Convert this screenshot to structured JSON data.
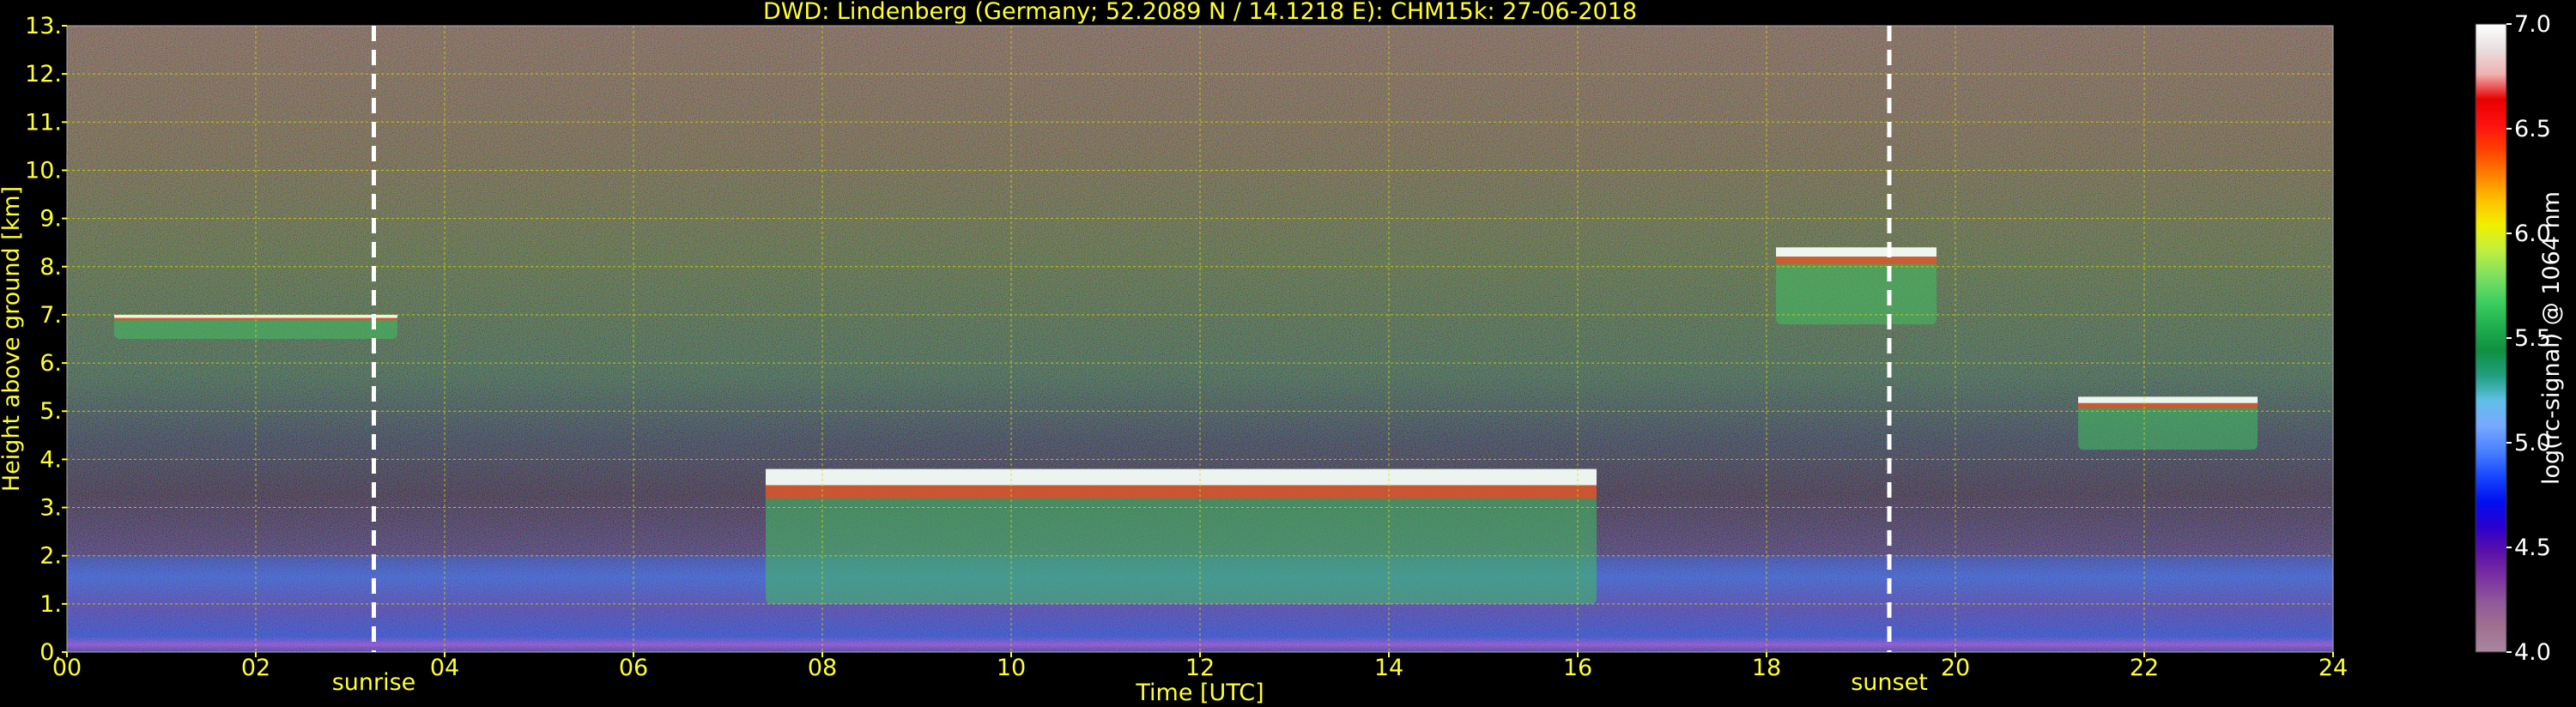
{
  "chart_data": {
    "type": "heatmap",
    "title": "DWD: Lindenberg (Germany; 52.2089 N / 14.1218 E):    CHM15k: 27-06-2018",
    "xlabel": "Time [UTC]",
    "ylabel": "Height above ground [km]",
    "xlim": [
      0,
      24
    ],
    "ylim": [
      0,
      13
    ],
    "x_ticks": [
      "00",
      "02",
      "04",
      "06",
      "08",
      "10",
      "12",
      "14",
      "16",
      "18",
      "20",
      "22",
      "24"
    ],
    "y_ticks": [
      "0.",
      "1.",
      "2.",
      "3.",
      "4.",
      "5.",
      "6.",
      "7.",
      "8.",
      "9.",
      "10.",
      "11.",
      "12.",
      "13."
    ],
    "grid": true,
    "markers": [
      {
        "label": "sunrise",
        "x": 3.25
      },
      {
        "label": "sunset",
        "x": 19.3
      }
    ],
    "colorbar": {
      "label": "log(rc-signal) @ 1064 nm",
      "range": [
        4.0,
        7.0
      ],
      "ticks": [
        "4.0",
        "4.5",
        "5.0",
        "5.5",
        "6.0",
        "6.5",
        "7.0"
      ],
      "colors": [
        "#a888a0",
        "#a07090",
        "#90589a",
        "#7a30a0",
        "#5a10a8",
        "#2a00d0",
        "#0010f0",
        "#1848ff",
        "#4a80ff",
        "#78a8ff",
        "#60c0e8",
        "#20a080",
        "#109040",
        "#20b050",
        "#40d060",
        "#80e060",
        "#c0f040",
        "#f0f000",
        "#ffc000",
        "#ff8000",
        "#ff4000",
        "#ff1010",
        "#e80000",
        "#f0b0b0",
        "#e8e0e0",
        "#ffffff"
      ]
    },
    "features": [
      {
        "kind": "boundary_layer",
        "x": [
          0,
          24
        ],
        "y": [
          0,
          2.0
        ]
      },
      {
        "kind": "cloud_layer",
        "x": [
          0.5,
          3.5
        ],
        "y": [
          6.5,
          7.0
        ]
      },
      {
        "kind": "cloud_layer",
        "x": [
          7.4,
          16.2
        ],
        "y": [
          1.0,
          3.8
        ]
      },
      {
        "kind": "cloud_layer",
        "x": [
          18.1,
          19.8
        ],
        "y": [
          6.8,
          8.4
        ]
      },
      {
        "kind": "cloud_layer",
        "x": [
          21.3,
          23.2
        ],
        "y": [
          4.2,
          5.3
        ]
      }
    ]
  }
}
